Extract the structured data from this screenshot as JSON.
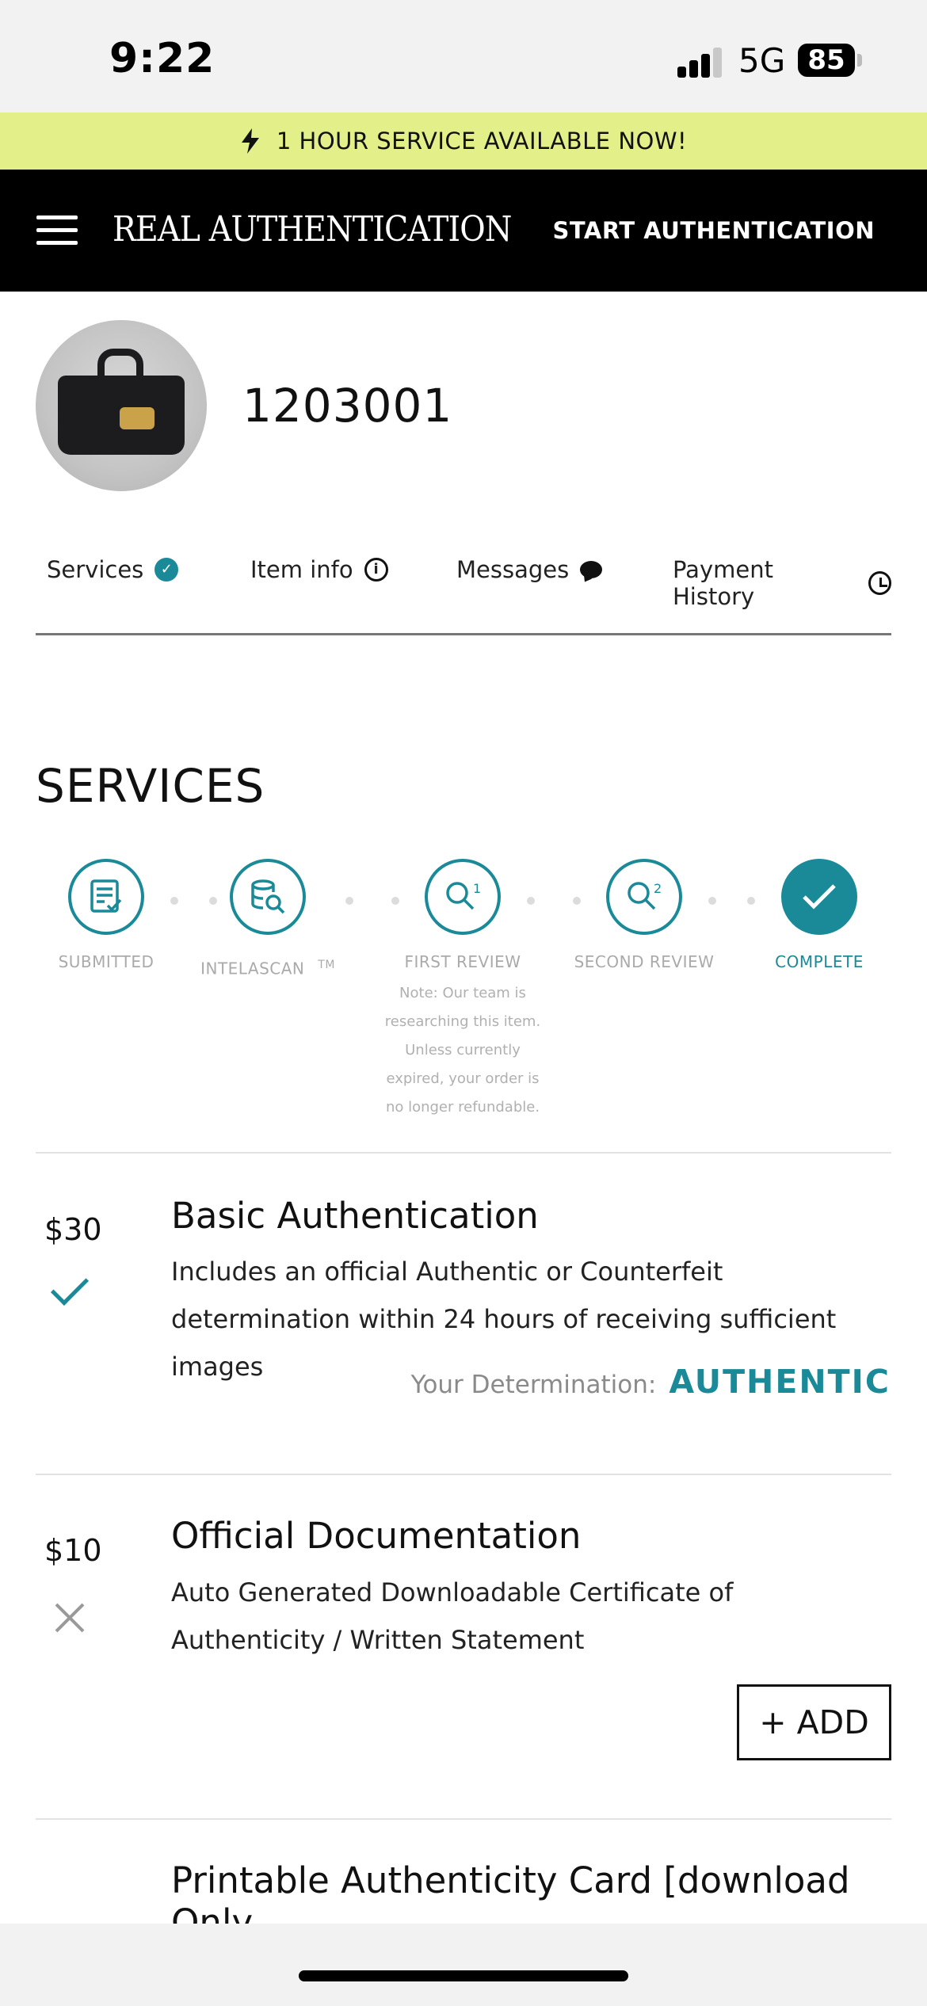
{
  "status_bar": {
    "time": "9:22",
    "network": "5G",
    "battery": "85"
  },
  "promo": {
    "text": "1 HOUR SERVICE AVAILABLE NOW!",
    "icon": "bolt-icon"
  },
  "header": {
    "brand": "REAL AUTHENTICATION",
    "cta": "START AUTHENTICATION",
    "menu_icon": "hamburger-menu-icon"
  },
  "item": {
    "id": "1203001"
  },
  "tabs": [
    {
      "label": "Services",
      "icon": "check-circle-icon"
    },
    {
      "label": "Item info",
      "icon": "info-icon"
    },
    {
      "label": "Messages",
      "icon": "chat-bubble-icon"
    },
    {
      "label": "Payment History",
      "icon": "history-icon"
    }
  ],
  "services": {
    "title": "SERVICES",
    "steps": [
      {
        "label": "SUBMITTED",
        "icon": "document-check-icon"
      },
      {
        "label": "INTELASCAN",
        "suffix": "TM",
        "icon": "database-search-icon"
      },
      {
        "label": "FIRST REVIEW",
        "icon": "search-1-icon",
        "note": "Note: Our team is researching this item. Unless currently expired, your order is no longer refundable."
      },
      {
        "label": "SECOND REVIEW",
        "icon": "search-2-icon"
      },
      {
        "label": "COMPLETE",
        "icon": "checkmark-icon"
      }
    ],
    "accent_color": "#1a8a99"
  },
  "offerings": [
    {
      "price": "$30",
      "title": "Basic Authentication",
      "description": "Includes an official Authentic or Counterfeit determination within 24 hours of receiving sufficient images",
      "status": "purchased",
      "determination_label": "Your Determination:",
      "determination_value": "AUTHENTIC"
    },
    {
      "price": "$10",
      "title": "Official Documentation",
      "description": "Auto Generated Downloadable Certificate of Authenticity / Written Statement",
      "status": "not-purchased",
      "add_label": "+ ADD"
    },
    {
      "title": "Printable Authenticity Card [download Only"
    }
  ]
}
